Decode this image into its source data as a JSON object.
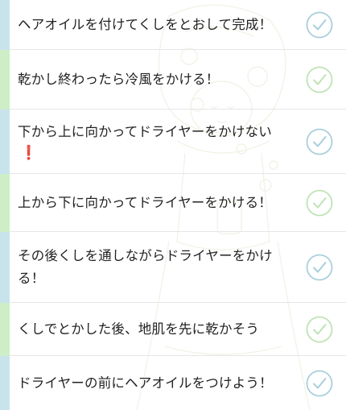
{
  "colors": {
    "accent_green": "#cdeec6",
    "accent_blue": "#c9e3ec",
    "check_green": "#bfe3b4",
    "check_blue": "#a9cfdc",
    "warning_red": "#e0241b"
  },
  "checklist": {
    "items": [
      {
        "label": "ヘアオイルを付けてくしをとおして完成！",
        "checked": false
      },
      {
        "label": "乾かし終わったら冷風をかける！",
        "checked": false
      },
      {
        "label": "下から上に向かってドライヤーをかけない",
        "warning": "❗",
        "checked": false
      },
      {
        "label": "上から下に向かってドライヤーをかける！",
        "checked": false
      },
      {
        "label": "その後くしを通しながらドライヤーをかける！",
        "checked": false
      },
      {
        "label": "くしでとかした後、地肌を先に乾かそう",
        "checked": false
      },
      {
        "label": "ドライヤーの前にヘアオイルをつけよう！",
        "checked": false
      }
    ]
  },
  "icons": {
    "check": "check-circle-icon",
    "background": "girl-illustration"
  }
}
